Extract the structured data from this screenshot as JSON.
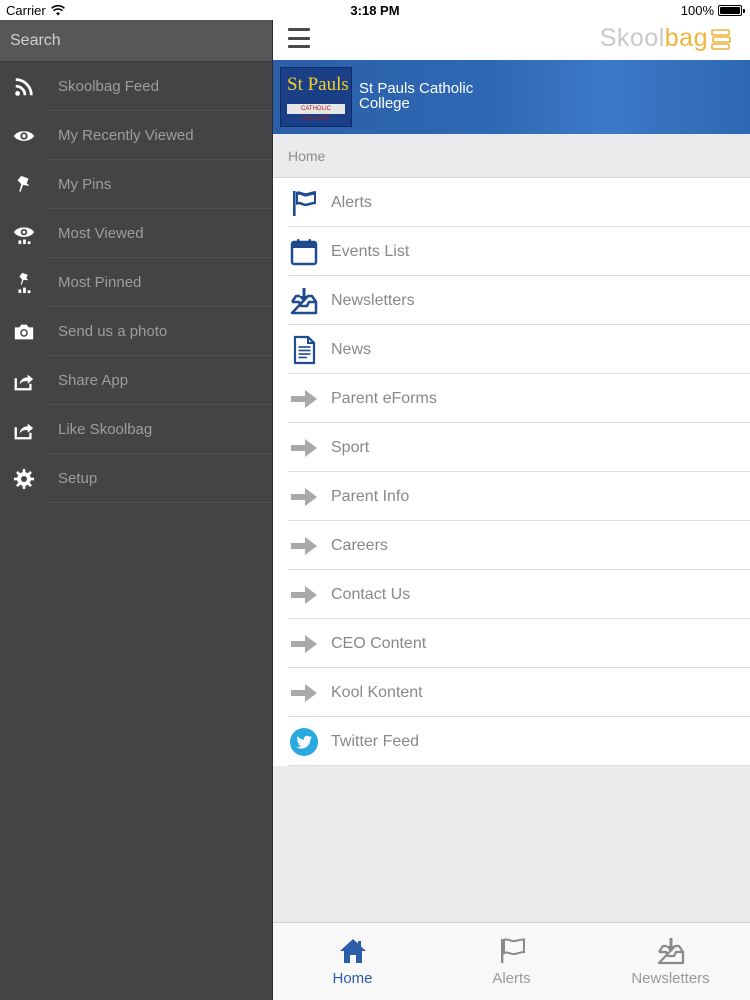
{
  "status": {
    "carrier": "Carrier",
    "time": "3:18 PM",
    "battery": "100%"
  },
  "sidebar": {
    "search_placeholder": "Search",
    "items": [
      {
        "label": "Skoolbag Feed",
        "icon": "rss-icon"
      },
      {
        "label": "My Recently Viewed",
        "icon": "eye-icon"
      },
      {
        "label": "My Pins",
        "icon": "pin-icon"
      },
      {
        "label": "Most Viewed",
        "icon": "eye-stats-icon"
      },
      {
        "label": "Most Pinned",
        "icon": "pin-stats-icon"
      },
      {
        "label": "Send us a photo",
        "icon": "camera-icon"
      },
      {
        "label": "Share App",
        "icon": "share-icon"
      },
      {
        "label": "Like Skoolbag",
        "icon": "share-icon"
      },
      {
        "label": "Setup",
        "icon": "gear-icon"
      }
    ]
  },
  "header": {
    "brand_grey": "Skool",
    "brand_orange": "bag"
  },
  "school": {
    "logo_text": "St Pauls",
    "logo_subtext": "CATHOLIC COLLEGE",
    "name": "St Pauls Catholic College"
  },
  "breadcrumb": "Home",
  "menu": {
    "items": [
      {
        "label": "Alerts",
        "icon": "flag-icon"
      },
      {
        "label": "Events List",
        "icon": "calendar-icon"
      },
      {
        "label": "Newsletters",
        "icon": "inbox-download-icon"
      },
      {
        "label": "News",
        "icon": "document-icon"
      },
      {
        "label": "Parent eForms",
        "icon": "arrow-right-icon"
      },
      {
        "label": "Sport",
        "icon": "arrow-right-icon"
      },
      {
        "label": "Parent Info",
        "icon": "arrow-right-icon"
      },
      {
        "label": "Careers",
        "icon": "arrow-right-icon"
      },
      {
        "label": "Contact Us",
        "icon": "arrow-right-icon"
      },
      {
        "label": "CEO Content",
        "icon": "arrow-right-icon"
      },
      {
        "label": "Kool Kontent",
        "icon": "arrow-right-icon"
      },
      {
        "label": "Twitter Feed",
        "icon": "twitter-icon"
      }
    ]
  },
  "tabs": [
    {
      "label": "Home",
      "icon": "home-icon",
      "active": true
    },
    {
      "label": "Alerts",
      "icon": "flag-icon",
      "active": false
    },
    {
      "label": "Newsletters",
      "icon": "inbox-download-icon",
      "active": false
    }
  ],
  "colors": {
    "sidebar_bg": "#444446",
    "accent_blue": "#2b5da8",
    "brand_orange": "#f0b43c",
    "banner_blue": "#2e68b4"
  }
}
